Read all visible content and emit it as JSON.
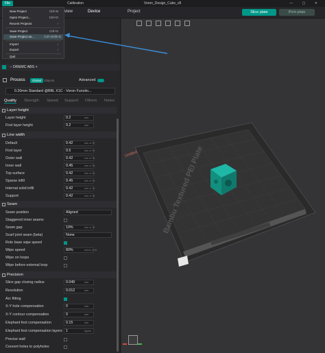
{
  "window": {
    "title": "Voron_Design_Cube_v8",
    "file_label": "File",
    "calibration": "Calibration"
  },
  "tabs": {
    "prepare": "view",
    "device": "Device",
    "project": "Project"
  },
  "top_buttons": {
    "slice": "Slice plate",
    "print": "Print plate"
  },
  "file_menu": {
    "items": [
      {
        "label": "New Project",
        "shortcut": "Ctrl+N"
      },
      {
        "label": "Open Project...",
        "shortcut": "Ctrl+O"
      },
      {
        "label": "Recent Projects",
        "shortcut": ""
      },
      {
        "label": "Save Project",
        "shortcut": "Ctrl+S"
      },
      {
        "label": "Save Project as...",
        "shortcut": "Ctrl+Shift+S"
      },
      {
        "label": "Import",
        "shortcut": ""
      },
      {
        "label": "Export",
        "shortcut": ""
      },
      {
        "label": "Quit",
        "shortcut": ""
      }
    ]
  },
  "filament": {
    "name": "-- DREMC ABS +"
  },
  "process": {
    "title": "Process",
    "global": "Global",
    "objects": "Objects",
    "advanced": "Advanced",
    "preset": "0.20mm Standard @BBL X1C - Voron Functio..."
  },
  "param_tabs": [
    "Quality",
    "Strength",
    "Speed",
    "Support",
    "Others",
    "Notes"
  ],
  "sections": {
    "layer_height": "Layer height",
    "line_width": "Line width",
    "seam": "Seam",
    "precision": "Precision"
  },
  "layer_height_rows": [
    {
      "label": "Layer height",
      "value": "0.2",
      "unit": "mm"
    },
    {
      "label": "First layer height",
      "value": "0.2",
      "unit": "mm"
    }
  ],
  "line_width_rows": [
    {
      "label": "Default",
      "value": "0.42",
      "unit": "mm or %"
    },
    {
      "label": "First layer",
      "value": "0.5",
      "unit": "mm or %"
    },
    {
      "label": "Outer wall",
      "value": "0.42",
      "unit": "mm or %"
    },
    {
      "label": "Inner wall",
      "value": "0.45",
      "unit": "mm or %"
    },
    {
      "label": "Top surface",
      "value": "0.42",
      "unit": "mm or %"
    },
    {
      "label": "Sparse infill",
      "value": "0.45",
      "unit": "mm or %"
    },
    {
      "label": "Internal solid infill",
      "value": "0.42",
      "unit": "mm or %"
    },
    {
      "label": "Support",
      "value": "0.42",
      "unit": "mm or %"
    }
  ],
  "seam_rows": [
    {
      "label": "Seam position",
      "value": "Aligned",
      "type": "select"
    },
    {
      "label": "Staggered inner seams",
      "type": "check",
      "on": false
    },
    {
      "label": "Seam gap",
      "value": "10%",
      "unit": "mm or %",
      "type": "input"
    },
    {
      "label": "Scarf joint seam (beta)",
      "value": "None",
      "type": "select"
    },
    {
      "label": "Role base wipe speed",
      "type": "check",
      "on": true
    },
    {
      "label": "Wipe speed",
      "value": "80%",
      "unit": "mm/s or %",
      "type": "input"
    },
    {
      "label": "Wipe on loops",
      "type": "check",
      "on": false
    },
    {
      "label": "Wipe before external loop",
      "type": "check",
      "on": false
    }
  ],
  "precision_rows": [
    {
      "label": "Slice gap closing radius",
      "value": "0.049",
      "unit": "mm",
      "type": "input"
    },
    {
      "label": "Resolution",
      "value": "0.012",
      "unit": "mm",
      "type": "input"
    },
    {
      "label": "Arc fitting",
      "type": "check",
      "on": true
    },
    {
      "label": "X-Y hole compensation",
      "value": "0",
      "unit": "mm",
      "type": "input"
    },
    {
      "label": "X-Y contour compensation",
      "value": "0",
      "unit": "mm",
      "type": "input"
    },
    {
      "label": "Elephant foot compensation",
      "value": "0.15",
      "unit": "mm",
      "type": "input"
    },
    {
      "label": "Elephant foot compensation layers",
      "value": "1",
      "unit": "layers",
      "type": "input"
    },
    {
      "label": "Precise wall",
      "type": "check",
      "on": false
    },
    {
      "label": "Convert holes to polyholes",
      "type": "check",
      "on": false
    }
  ],
  "plate": {
    "label": "Bambu Textured PEI Plate",
    "untitled": "Untitled",
    "plate_no": "1"
  },
  "colors": {
    "accent": "#009688",
    "cube": "#14a596",
    "arrow": "#3b8fd9"
  }
}
